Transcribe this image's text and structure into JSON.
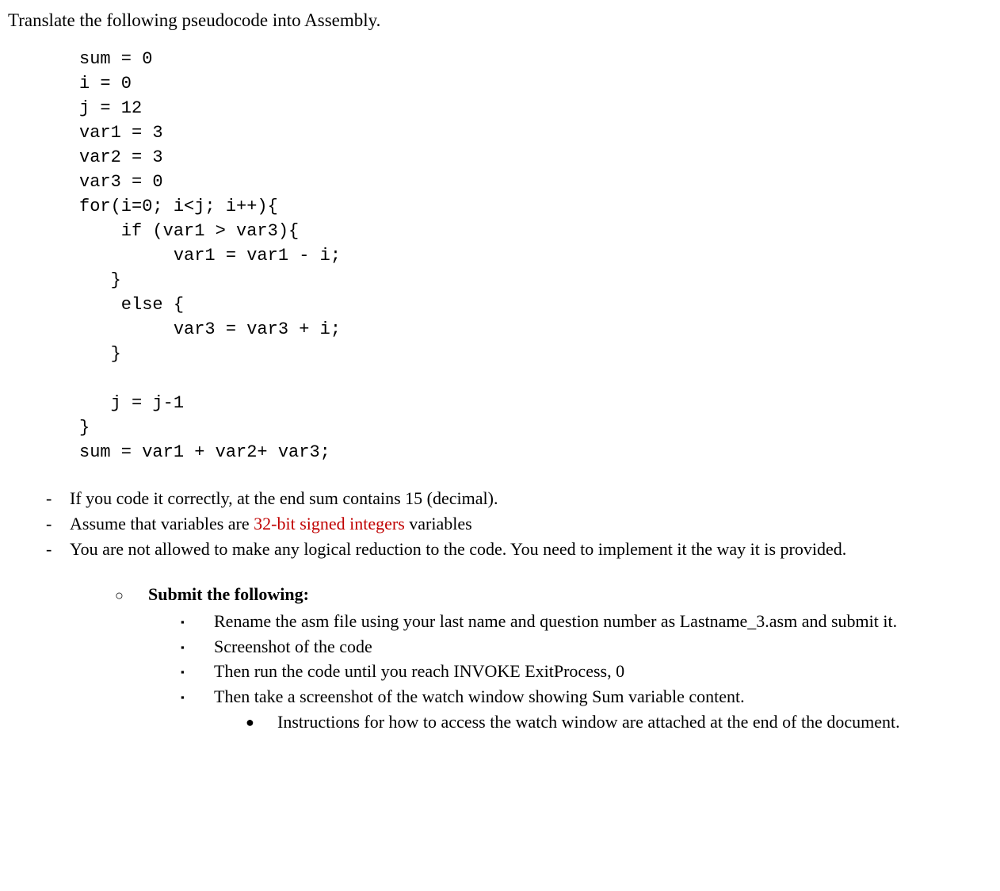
{
  "heading": "Translate the following pseudocode into Assembly.",
  "code": "sum = 0\ni = 0\nj = 12\nvar1 = 3\nvar2 = 3\nvar3 = 0\nfor(i=0; i<j; i++){\n    if (var1 > var3){\n         var1 = var1 - i;\n   }\n    else {\n         var3 = var3 + i;\n   }\n\n   j = j-1\n}\nsum = var1 + var2+ var3;",
  "dashes": {
    "item1": "If you code it correctly, at the end sum contains 15 (decimal).",
    "item2_pre": "Assume that variables are ",
    "item2_red": "32-bit signed integers",
    "item2_post": " variables",
    "item3": "You are not allowed to make any logical reduction to the code. You need to implement it the way it is provided."
  },
  "submit_header": "Submit the following:",
  "squares": {
    "s1": "Rename the asm file using your last name and question number as Lastname_3.asm and submit it.",
    "s2": "Screenshot of the code",
    "s3": "Then run the code until you reach INVOKE ExitProcess, 0",
    "s4": "Then take a screenshot of the watch window showing Sum variable content."
  },
  "bullet": "Instructions for how to access the watch window are attached at the end of the document.",
  "markers": {
    "dash": "-",
    "circle": "○",
    "square": "▪",
    "bullet": "●"
  }
}
